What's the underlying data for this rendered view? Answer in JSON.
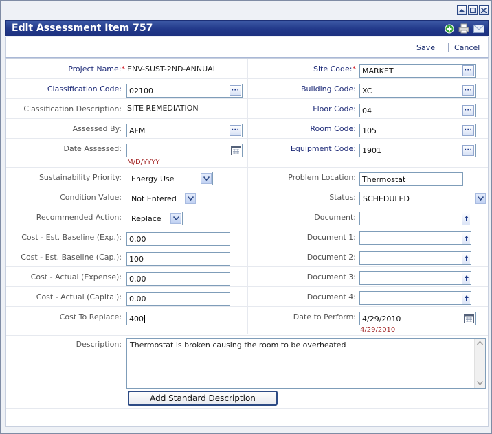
{
  "window": {
    "title": "Edit Assessment Item 757",
    "controls": [
      "minimize",
      "maximize",
      "close"
    ]
  },
  "actions": {
    "save": "Save",
    "cancel": "Cancel"
  },
  "icons": {
    "title_icons": [
      "add-icon",
      "print-icon",
      "email-icon"
    ],
    "lookup": "...",
    "calendar": "calendar-icon",
    "upload": "upload-arrow-icon"
  },
  "fields": {
    "project_name": {
      "label": "Project Name:",
      "value": "ENV-SUST-2ND-ANNUAL",
      "required": true
    },
    "site_code": {
      "label": "Site Code:",
      "value": "MARKET",
      "required": true
    },
    "classification_code": {
      "label": "Classification Code:",
      "value": "02100"
    },
    "building_code": {
      "label": "Building Code:",
      "value": "XC"
    },
    "classification_description": {
      "label": "Classification Description:",
      "value": "SITE REMEDIATION"
    },
    "floor_code": {
      "label": "Floor Code:",
      "value": "04"
    },
    "assessed_by": {
      "label": "Assessed By:",
      "value": "AFM"
    },
    "room_code": {
      "label": "Room Code:",
      "value": "105"
    },
    "date_assessed": {
      "label": "Date Assessed:",
      "value": "",
      "hint": "M/D/YYYY"
    },
    "equipment_code": {
      "label": "Equipment Code:",
      "value": "1901"
    },
    "sustainability_priority": {
      "label": "Sustainability Priority:",
      "value": "Energy Use"
    },
    "problem_location": {
      "label": "Problem Location:",
      "value": "Thermostat"
    },
    "condition_value": {
      "label": "Condition Value:",
      "value": "Not Entered"
    },
    "status": {
      "label": "Status:",
      "value": "SCHEDULED"
    },
    "recommended_action": {
      "label": "Recommended Action:",
      "value": "Replace"
    },
    "document": {
      "label": "Document:",
      "value": ""
    },
    "cost_est_baseline_exp": {
      "label": "Cost - Est. Baseline (Exp.):",
      "value": "0.00"
    },
    "document_1": {
      "label": "Document 1:",
      "value": ""
    },
    "cost_est_baseline_cap": {
      "label": "Cost - Est. Baseline (Cap.):",
      "value": "100"
    },
    "document_2": {
      "label": "Document 2:",
      "value": ""
    },
    "cost_actual_expense": {
      "label": "Cost - Actual (Expense):",
      "value": "0.00"
    },
    "document_3": {
      "label": "Document 3:",
      "value": ""
    },
    "cost_actual_capital": {
      "label": "Cost - Actual (Capital):",
      "value": "0.00"
    },
    "document_4": {
      "label": "Document 4:",
      "value": ""
    },
    "cost_to_replace": {
      "label": "Cost To Replace:",
      "value": "400"
    },
    "date_to_perform": {
      "label": "Date to Perform:",
      "value": "4/29/2010",
      "hint": "4/29/2010"
    },
    "description": {
      "label": "Description:",
      "value": "Thermostat is broken causing the room to be overheated"
    }
  },
  "buttons": {
    "add_standard_description": "Add Standard Description"
  },
  "colors": {
    "title_bar": "#22398a",
    "required_star": "#d2222d",
    "hint_text": "#a52a2a",
    "label_blue": "#1d2a77"
  }
}
